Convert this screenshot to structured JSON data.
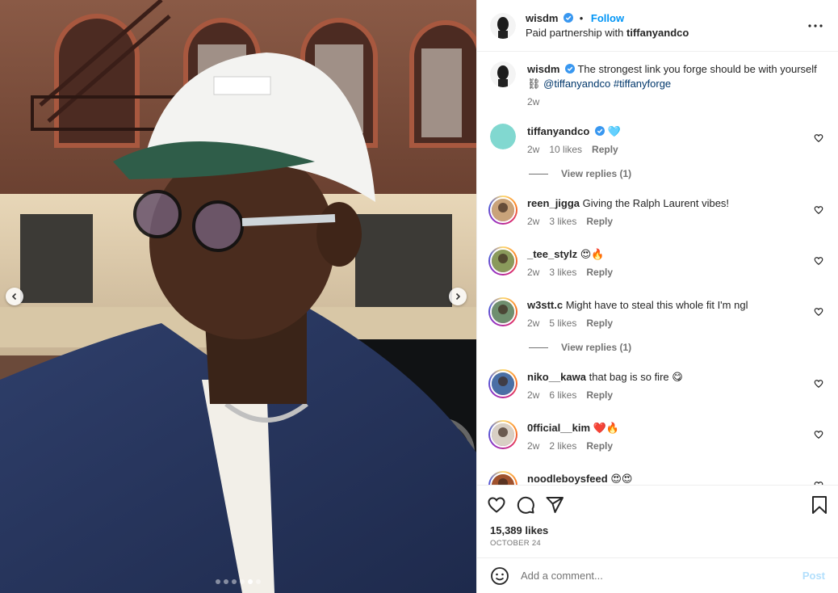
{
  "post": {
    "author": "wisdm",
    "follow_label": "Follow",
    "separator": "•",
    "partnership_prefix": "Paid partnership with",
    "partner": "tiffanyandco",
    "caption_text": "The strongest link you forge should be with yourself",
    "caption_emoji": "⛓",
    "caption_mention": "@tiffanyandco",
    "caption_hashtag": "#tiffanyforge",
    "caption_time": "2w",
    "likes": "15,389 likes",
    "date": "OCTOBER 24",
    "carousel": {
      "slides": 6,
      "active_index": 4
    }
  },
  "comments": [
    {
      "user": "tiffanyandco",
      "text": "🩵",
      "time": "2w",
      "likes": "10 likes",
      "reply": "Reply",
      "verified": true,
      "view_replies": "View replies (1)",
      "avatar_color": "#81d8d0"
    },
    {
      "user": "reen_jigga",
      "text": "Giving the Ralph Laurent vibes!",
      "time": "2w",
      "likes": "3 likes",
      "reply": "Reply",
      "avatar_color": "#c9a37a"
    },
    {
      "user": "_tee_stylz",
      "text": "😍🔥",
      "time": "2w",
      "likes": "3 likes",
      "reply": "Reply",
      "avatar_color": "#8a9a5b"
    },
    {
      "user": "w3stt.c",
      "text": "Might have to steal this whole fit I'm ngl",
      "time": "2w",
      "likes": "5 likes",
      "reply": "Reply",
      "view_replies": "View replies (1)",
      "avatar_color": "#6f8f6f"
    },
    {
      "user": "niko__kawa",
      "text": "that bag is so fire 😋",
      "time": "2w",
      "likes": "6 likes",
      "reply": "Reply",
      "avatar_color": "#4a6fa5"
    },
    {
      "user": "0fficial__kim",
      "text": "❤️🔥",
      "time": "2w",
      "likes": "2 likes",
      "reply": "Reply",
      "avatar_color": "#d8cfc4"
    },
    {
      "user": "noodleboysfeed",
      "text": "😍😍",
      "time": "",
      "likes": "",
      "reply": "",
      "avatar_color": "#a0522d"
    }
  ],
  "composer": {
    "placeholder": "Add a comment...",
    "post_label": "Post"
  },
  "colors": {
    "accent": "#0095f6",
    "verified": "#3897f0",
    "muted": "#737373"
  },
  "icons": [
    "chevron-left-icon",
    "chevron-right-icon",
    "verified-icon",
    "more-icon",
    "heart-icon",
    "comment-icon",
    "share-icon",
    "bookmark-icon",
    "emoji-icon"
  ]
}
